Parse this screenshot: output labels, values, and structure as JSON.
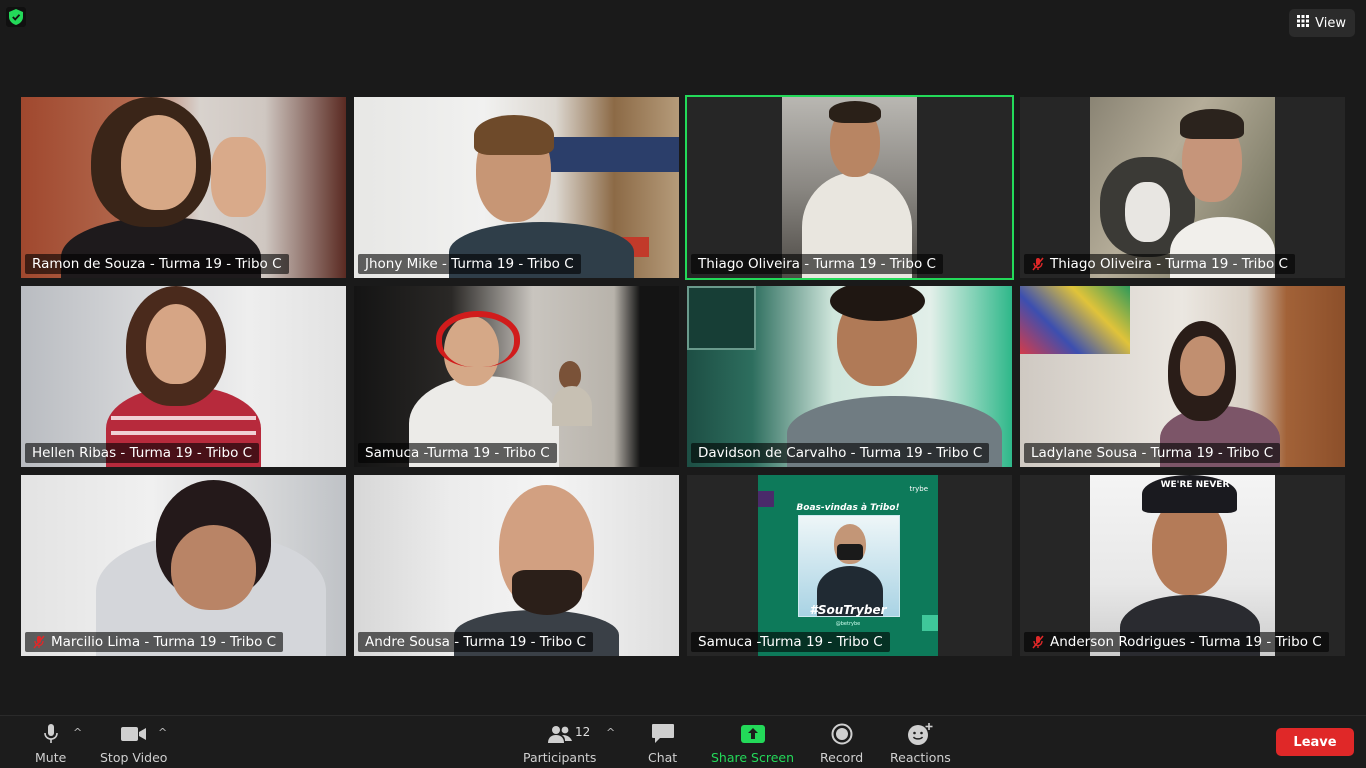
{
  "top": {
    "view_label": "View",
    "security_icon": "shield-check-icon"
  },
  "participants": [
    {
      "name": "Ramon de Souza - Turma 19 - Tribo C",
      "muted": false,
      "active": false
    },
    {
      "name": "Jhony Mike - Turma 19 - Tribo C",
      "muted": false,
      "active": false
    },
    {
      "name": "Thiago Oliveira - Turma 19 - Tribo C",
      "muted": false,
      "active": true
    },
    {
      "name": "Thiago Oliveira - Turma 19 - Tribo C",
      "muted": true,
      "active": false
    },
    {
      "name": "Hellen Ribas - Turma 19 - Tribo C",
      "muted": false,
      "active": false
    },
    {
      "name": "Samuca -Turma 19 - Tribo C",
      "muted": false,
      "active": false
    },
    {
      "name": "Davidson de Carvalho - Turma 19 - Tribo C",
      "muted": false,
      "active": false
    },
    {
      "name": "Ladylane Sousa - Turma 19 - Tribo C",
      "muted": false,
      "active": false
    },
    {
      "name": "Marcilio Lima - Turma 19 - Tribo C",
      "muted": true,
      "active": false
    },
    {
      "name": "Andre Sousa - Turma 19 - Tribo C",
      "muted": false,
      "active": false
    },
    {
      "name": "Samuca -Turma 19 - Tribo C",
      "muted": false,
      "active": false
    },
    {
      "name": "Anderson Rodrigues - Turma 19 - Tribo C",
      "muted": true,
      "active": false
    }
  ],
  "poster": {
    "brand": "trybe",
    "headline": "Boas-vindas à Tribo!",
    "hashtag": "#SouTryber",
    "handle": "@betrybe"
  },
  "cap_text": "WE'RE NEVER",
  "toolbar": {
    "mute": "Mute",
    "stop_video": "Stop Video",
    "participants": "Participants",
    "participants_count": "12",
    "chat": "Chat",
    "share_screen": "Share Screen",
    "record": "Record",
    "reactions": "Reactions",
    "leave": "Leave"
  },
  "colors": {
    "accent_green": "#23d959",
    "leave_red": "#e02828",
    "poster_green": "#0d7a5a"
  }
}
